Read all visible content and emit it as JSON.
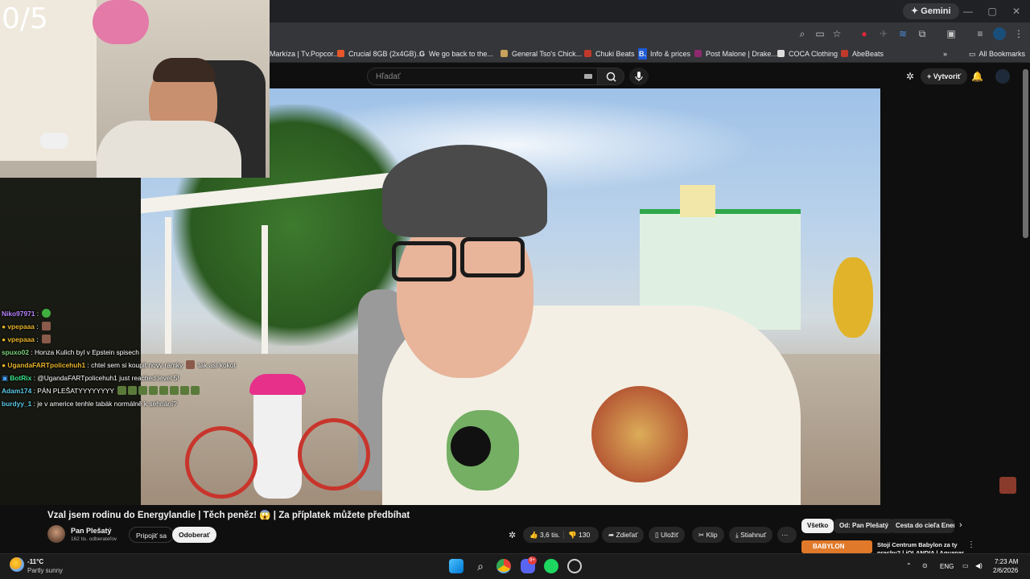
{
  "stream_overlay": {
    "score": "0/5",
    "chat": [
      {
        "user": "Niko97971",
        "user_color": "#b983ff",
        "badge": "",
        "message": "",
        "emote": "#3fae3f"
      },
      {
        "user": "vpepaaa",
        "user_color": "#e8b428",
        "badge": "●",
        "message": "",
        "emote": "#8a5a4a"
      },
      {
        "user": "vpepaaa",
        "user_color": "#e8b428",
        "badge": "●",
        "message": "",
        "emote": "#8a5a4a"
      },
      {
        "user": "spuxo02",
        "user_color": "#7ad17a",
        "badge": "",
        "message": "Honza Kulich byl v Epstein spisech",
        "emote": ""
      },
      {
        "user": "UgandaFARTpolicehuh1",
        "user_color": "#e8b428",
        "badge": "●",
        "message": "chtel sem si koupit novy ramky",
        "emote": "#8a5a4a",
        "after": "tak asi kokot"
      },
      {
        "user": "BotRix",
        "user_color": "#39e58c",
        "badge": "▣",
        "message": "@UgandaFARTpolicehuh1 just reached level 5!",
        "emote": ""
      },
      {
        "user": "Adam174",
        "user_color": "#5bc8e8",
        "badge": "",
        "message": "PÁN PLEŠATYYYYYYYY",
        "emote": "#5a7a3a",
        "repeat": 8
      },
      {
        "user": "burdyy_1",
        "user_color": "#5bc8e8",
        "badge": "",
        "message": "je v americe tenhle tabák normálně k sehnání?",
        "emote": ""
      }
    ]
  },
  "browser": {
    "gemini": "Gemini",
    "bookmarks": [
      {
        "label": "Markíza | Tv.Popcor...",
        "color": "#5b6fd6"
      },
      {
        "label": "Crucial 8GB (2x4GB)...",
        "color": "#e8572a"
      },
      {
        "label": "We go back to the...",
        "color": "#ffffff",
        "glyph": "G"
      },
      {
        "label": "General Tso's Chick...",
        "color": "#c9a15a"
      },
      {
        "label": "Chuki Beats",
        "color": "#c0392b"
      },
      {
        "label": "Info & prices",
        "color": "#1e5bd7",
        "glyph": "B."
      },
      {
        "label": "Post Malone | Drake...",
        "color": "#8e2a6e"
      },
      {
        "label": "COCA Clothing",
        "color": "#222222"
      },
      {
        "label": "AbeBeats",
        "color": "#c0392b"
      }
    ],
    "all_bookmarks": "All Bookmarks"
  },
  "youtube": {
    "search_placeholder": "Hľadať",
    "create_label": "Vytvoriť",
    "video_title": "Vzal jsem rodinu do Energylandie | Těch peněz! 😱 | Za příplatek můžete předbíhat",
    "channel_name": "Pan Plešatý",
    "channel_subs": "162 tis. odberateľov",
    "join_label": "Pripojiť sa",
    "subscribe_label": "Odoberať",
    "likes": "3,6 tis.",
    "dislikes": "130",
    "share_label": "Zdieľať",
    "save_label": "Uložiť",
    "clip_label": "Klip",
    "download_label": "Stiahnuť",
    "more_label": "···",
    "chips": [
      "Všetko",
      "Od: Pan Plešatý",
      "Cesta do cieľa Energ"
    ],
    "next_video_title": "Stojí Centrum Babylon za ty",
    "next_video_title2": "prachy? | iQLANDIA | Aquapar",
    "next_video_thumb_text": "BABYLON LIBEREC"
  },
  "taskbar": {
    "temperature": "-11°C",
    "weather": "Partly sunny",
    "language": "ENG",
    "time": "7:23 AM",
    "date": "2/6/2026",
    "discord_badge": "9+"
  }
}
